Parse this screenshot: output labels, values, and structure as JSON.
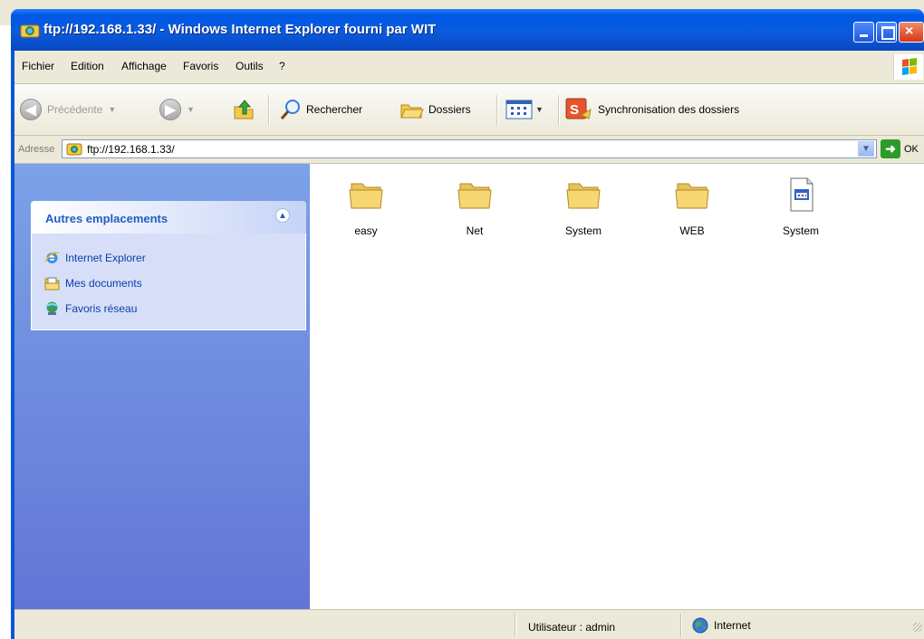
{
  "window": {
    "title": "ftp://192.168.1.33/ - Windows Internet Explorer fourni par WIT",
    "controls": {
      "minimize": "minimize",
      "maximize": "maximize",
      "close": "×"
    }
  },
  "menu": {
    "items": [
      "Fichier",
      "Edition",
      "Affichage",
      "Favoris",
      "Outils",
      "?"
    ]
  },
  "toolbar": {
    "back_label": "Précédente",
    "search_label": "Rechercher",
    "folders_label": "Dossiers",
    "sync_label": "Synchronisation des dossiers"
  },
  "address": {
    "label": "Adresse",
    "value": "ftp://192.168.1.33/",
    "go_label": "OK"
  },
  "sidebar": {
    "panel_title": "Autres emplacements",
    "links": [
      {
        "label": "Internet Explorer",
        "icon": "ie-icon"
      },
      {
        "label": "Mes documents",
        "icon": "documents-icon"
      },
      {
        "label": "Favoris réseau",
        "icon": "network-icon"
      }
    ]
  },
  "files": [
    {
      "name": "easy",
      "type": "folder"
    },
    {
      "name": "Net",
      "type": "folder"
    },
    {
      "name": "System",
      "type": "folder"
    },
    {
      "name": "WEB",
      "type": "folder"
    },
    {
      "name": "System",
      "type": "file"
    }
  ],
  "status": {
    "user": "Utilisateur : admin",
    "zone": "Internet"
  },
  "colors": {
    "title_blue": "#0a5bde",
    "sidebar_top": "#7ba2e7",
    "sidebar_bottom": "#6375d6",
    "panel_title": "#215dc6",
    "link_text": "#0c3dac",
    "folder_yellow": "#f7d774"
  }
}
